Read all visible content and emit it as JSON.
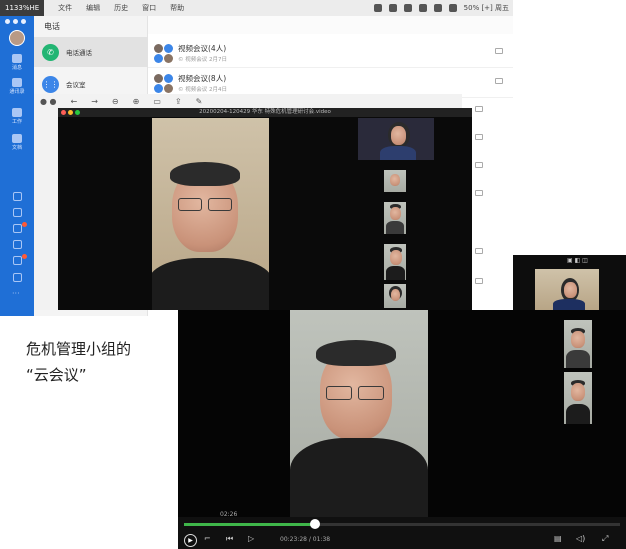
{
  "menubar": {
    "app_name": "1133%HE",
    "menus": [
      "文件",
      "编辑",
      "历史",
      "窗口",
      "帮助"
    ],
    "status_text": "50% [+]  周五"
  },
  "sidebar": {
    "items": [
      {
        "label": "消息",
        "icon": "chat-icon"
      },
      {
        "label": "通讯录",
        "icon": "contacts-icon"
      },
      {
        "label": "工作",
        "icon": "work-icon"
      },
      {
        "label": "文档",
        "icon": "docs-icon"
      }
    ]
  },
  "list_pane": {
    "title": "电话",
    "rows": [
      {
        "label": "电话通话",
        "color": "#22b573",
        "icon": "phone-icon"
      },
      {
        "label": "会议室",
        "color": "#3c86e8",
        "icon": "dial-pad-icon"
      }
    ]
  },
  "conversations": [
    {
      "title": "视频会议(4人)",
      "subtitle": "© 视频会议 2月7日"
    },
    {
      "title": "视频会议(8人)",
      "subtitle": "© 视频会议 2月4日"
    }
  ],
  "player1": {
    "toolbar_icons": [
      "back-icon",
      "forward-icon",
      "zoom-out-icon",
      "zoom-in-icon",
      "crop-icon",
      "share-icon",
      "tools-icon"
    ],
    "filename": "20200204-120429 华东 特殊危机管理研讨会.video"
  },
  "player2": {
    "current_time": "02:26",
    "bottom_time": "00:23:28 / 01:38",
    "progress_fraction": 0.3
  },
  "caption": {
    "line1": "危机管理小组的",
    "line2": "“云会议”"
  },
  "colors": {
    "sidebar": "#1f6fd6",
    "progress": "#3fb64a"
  }
}
